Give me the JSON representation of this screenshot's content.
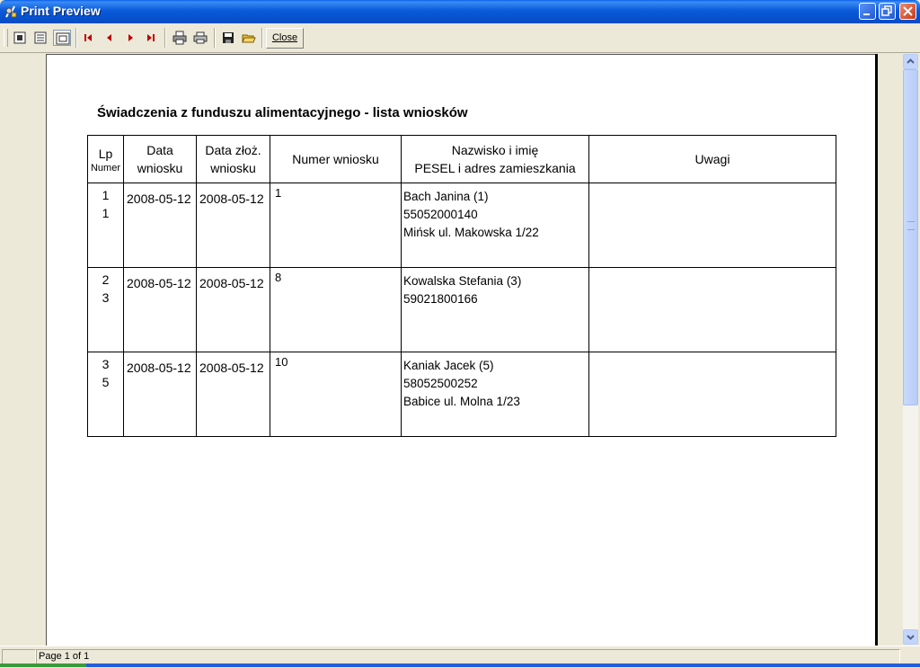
{
  "window": {
    "title": "Print Preview"
  },
  "toolbar": {
    "close_label": "Close",
    "icons": [
      "one-page-icon",
      "multi-page-icon",
      "zoom-fit-icon",
      "first-page-icon",
      "prev-page-icon",
      "next-page-icon",
      "last-page-icon",
      "print-setup-icon",
      "print-icon",
      "save-icon",
      "open-icon"
    ]
  },
  "report": {
    "title": "Świadczenia z funduszu alimentacyjnego - lista wniosków",
    "headers": {
      "lp": "Lp",
      "lp_sub": "Numer",
      "date1_a": "Data",
      "date1_b": "wniosku",
      "date2_a": "Data złoż.",
      "date2_b": "wniosku",
      "number": "Numer wniosku",
      "name_a": "Nazwisko i imię",
      "name_b": "PESEL i adres zamieszkania",
      "remarks": "Uwagi"
    },
    "rows": [
      {
        "lp": "1",
        "numer": "1",
        "data_wniosku": "2008-05-12",
        "data_zloz": "2008-05-12",
        "numer_wniosku": "1",
        "name": "Bach Janina (1)",
        "pesel": "55052000140",
        "address": "Mińsk ul. Makowska 1/22",
        "uwagi": ""
      },
      {
        "lp": "2",
        "numer": "3",
        "data_wniosku": "2008-05-12",
        "data_zloz": "2008-05-12",
        "numer_wniosku": "8",
        "name": "Kowalska Stefania (3)",
        "pesel": "59021800166",
        "address": "",
        "uwagi": ""
      },
      {
        "lp": "3",
        "numer": "5",
        "data_wniosku": "2008-05-12",
        "data_zloz": "2008-05-12",
        "numer_wniosku": "10",
        "name": "Kaniak Jacek (5)",
        "pesel": "58052500252",
        "address": "Babice ul. Molna 1/23",
        "uwagi": ""
      }
    ]
  },
  "status": {
    "page_info": "Page 1 of 1"
  },
  "colors": {
    "titlebar": "#0b5ad9",
    "chrome": "#ece9d8",
    "paper": "#ffffff",
    "nav_arrow": "#c00000"
  }
}
